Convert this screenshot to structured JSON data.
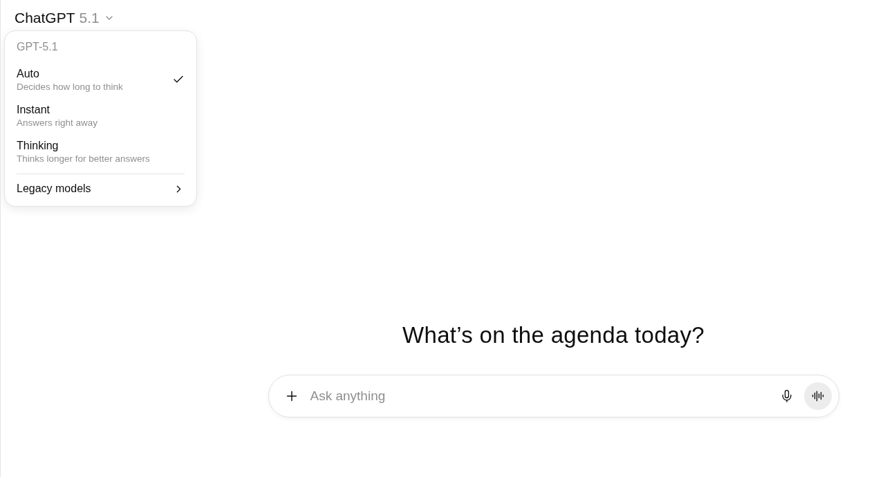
{
  "header": {
    "title": "ChatGPT",
    "version": "5.1"
  },
  "model_menu": {
    "heading": "GPT-5.1",
    "options": [
      {
        "label": "Auto",
        "description": "Decides how long to think",
        "selected": true
      },
      {
        "label": "Instant",
        "description": "Answers right away",
        "selected": false
      },
      {
        "label": "Thinking",
        "description": "Thinks longer for better answers",
        "selected": false
      }
    ],
    "submenu": {
      "label": "Legacy models"
    }
  },
  "greeting": "What’s on the agenda today?",
  "composer": {
    "placeholder": "Ask anything"
  }
}
